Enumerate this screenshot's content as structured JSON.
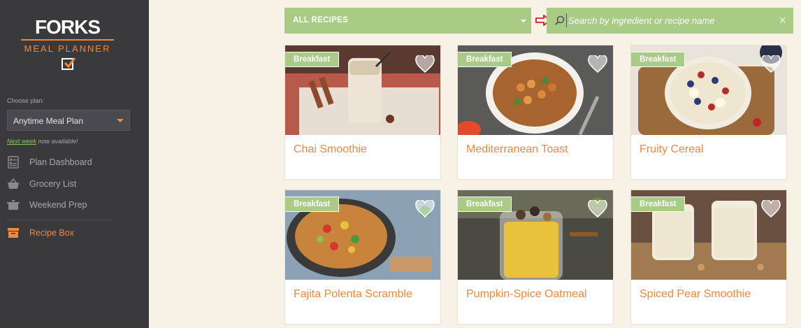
{
  "sidebar": {
    "logo_top": "FORKS",
    "logo_sub": "MEAL PLANNER",
    "choose_label": "Choose plan:",
    "plan_selected": "Anytime Meal Plan",
    "next_week_link": "Next week",
    "next_week_rest": "now available!",
    "nav": [
      {
        "label": "Plan Dashboard",
        "icon": "dashboard-icon"
      },
      {
        "label": "Grocery List",
        "icon": "basket-icon"
      },
      {
        "label": "Weekend Prep",
        "icon": "pot-icon"
      },
      {
        "label": "Recipe Box",
        "icon": "box-icon",
        "active": true
      }
    ]
  },
  "toolbar": {
    "category": "ALL RECIPES",
    "search_placeholder": "Search by ingredient or recipe name",
    "clear": "×"
  },
  "recipes": [
    {
      "badge": "Breakfast",
      "title": "Chai Smoothie"
    },
    {
      "badge": "Breakfast",
      "title": "Mediterranean Toast"
    },
    {
      "badge": "Breakfast",
      "title": "Fruity Cereal"
    },
    {
      "badge": "Breakfast",
      "title": "Fajita Polenta Scramble"
    },
    {
      "badge": "Breakfast",
      "title": "Pumpkin-Spice Oatmeal"
    },
    {
      "badge": "Breakfast",
      "title": "Spiced Pear Smoothie"
    }
  ],
  "colors": {
    "accent": "#f0883e",
    "green": "#a8cb86",
    "sidebar": "#3a3a3d",
    "background": "#f7f1e6"
  }
}
